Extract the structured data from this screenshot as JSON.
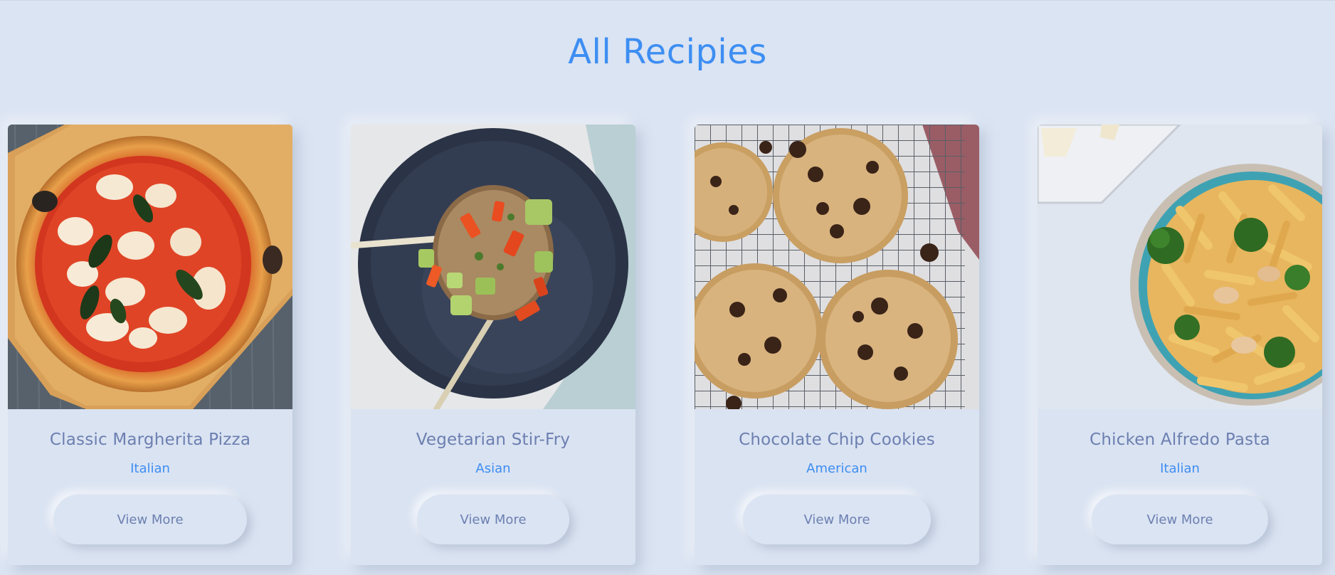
{
  "page": {
    "title": "All Recipies"
  },
  "recipes": [
    {
      "name": "Classic Margherita Pizza",
      "category": "Italian",
      "button_label": "View More",
      "image_icon": "pizza-photo"
    },
    {
      "name": "Vegetarian Stir-Fry",
      "category": "Asian",
      "button_label": "View More",
      "image_icon": "stir-fry-photo"
    },
    {
      "name": "Chocolate Chip Cookies",
      "category": "American",
      "button_label": "View More",
      "image_icon": "cookies-photo"
    },
    {
      "name": "Chicken Alfredo Pasta",
      "category": "Italian",
      "button_label": "View More",
      "image_icon": "pasta-photo"
    }
  ],
  "colors": {
    "background": "#dbe4f3",
    "accent": "#3d8ef2",
    "text_muted": "#6c7fb0"
  }
}
